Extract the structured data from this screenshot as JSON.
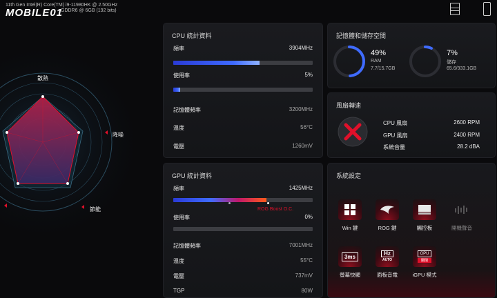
{
  "header": {
    "cpu_model": "11th Gen Intel(R) Core(TM) i9-11980HK @ 2.50GHz",
    "gpu_model": "GDDR6 @ 6GB (192 bits)",
    "logo": "MOBILE01"
  },
  "radar": {
    "labels": [
      "散熱",
      "降噪",
      "節能"
    ]
  },
  "cpu": {
    "title": "CPU 統計資料",
    "freq_label": "頻率",
    "freq_value": "3904MHz",
    "freq_fraction": 0.62,
    "usage_label": "使用率",
    "usage_value": "5%",
    "usage_fraction": 0.05,
    "mem_freq_label": "記憶體頻率",
    "mem_freq_value": "3200MHz",
    "temp_label": "溫度",
    "temp_value": "56°C",
    "volt_label": "電壓",
    "volt_value": "1260mV"
  },
  "gpu": {
    "title": "GPU 統計資料",
    "freq_label": "頻率",
    "freq_value": "1425MHz",
    "freq_fraction": 0.67,
    "boost_label": "ROG Boost O.C.",
    "usage_label": "使用率",
    "usage_value": "0%",
    "usage_fraction": 0.0,
    "mem_freq_label": "記憶體頻率",
    "mem_freq_value": "7001MHz",
    "temp_label": "溫度",
    "temp_value": "55°C",
    "volt_label": "電壓",
    "volt_value": "737mV",
    "tgp_label": "TGP",
    "tgp_value": "80W"
  },
  "memory": {
    "title": "記憶體和儲存空間",
    "ram_percent": "49%",
    "ram_label": "RAM",
    "ram_detail": "7.7/15.7GB",
    "ram_fraction": 0.49,
    "storage_percent": "7%",
    "storage_label": "儲存",
    "storage_detail": "65.6/933.1GB",
    "storage_fraction": 0.07
  },
  "fan": {
    "title": "風扇轉速",
    "cpu_fan_label": "CPU 風扇",
    "cpu_fan_value": "2600 RPM",
    "gpu_fan_label": "GPU 風扇",
    "gpu_fan_value": "2400 RPM",
    "noise_label": "系統音量",
    "noise_value": "28.2 dBA"
  },
  "settings": {
    "title": "系統設定",
    "items": [
      {
        "label": "Win 鍵",
        "icon": "windows-key-icon",
        "on": true
      },
      {
        "label": "ROG 鍵",
        "icon": "rog-key-icon",
        "on": true
      },
      {
        "label": "觸控板",
        "icon": "touchpad-icon",
        "on": true
      },
      {
        "label": "開機聲音",
        "icon": "boot-sound-icon",
        "on": false
      },
      {
        "label": "螢幕快顯",
        "icon": "screen-overdrive-icon",
        "on": true
      },
      {
        "label": "面板音電",
        "icon": "panel-hz-icon",
        "on": true
      },
      {
        "label": "iGPU 模式",
        "icon": "igpu-mode-icon",
        "on": true
      }
    ],
    "icon_text": {
      "overdrive": "3ms",
      "hz": "Hz",
      "hz_sub": "AUTO",
      "gpu": "GPU",
      "gpu_badge": "關閉"
    }
  },
  "colors": {
    "accent_red": "#e0102a",
    "accent_blue": "#3f6bff",
    "panel_bg": "#17181c"
  }
}
